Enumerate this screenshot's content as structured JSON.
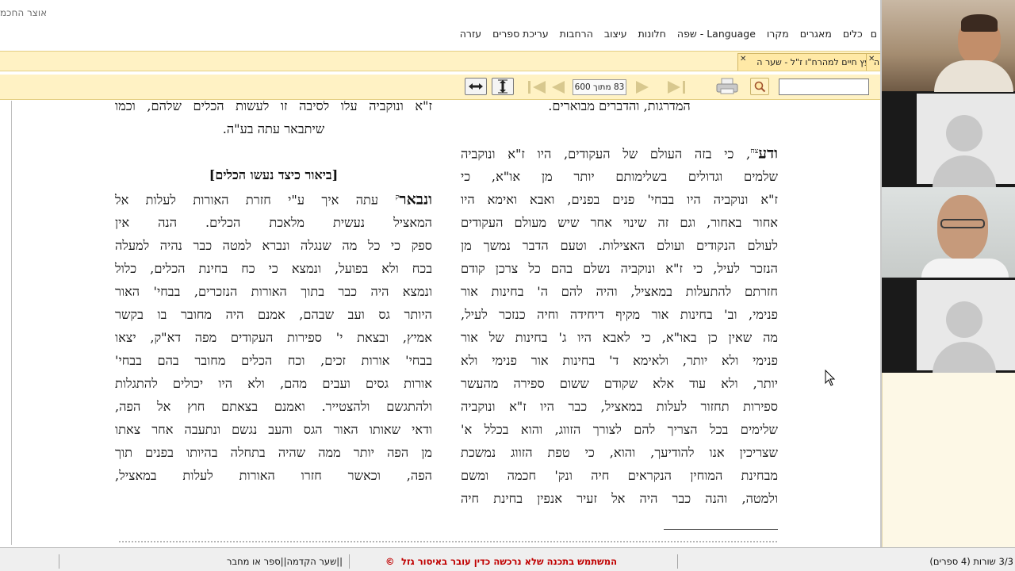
{
  "window": {
    "title": "אוצר החכמ"
  },
  "menu": [
    "כלים",
    "מאגרים",
    "מקרו",
    "Language - שפה",
    "חלונות",
    "עיצוב",
    "הרחבות",
    "עריכת ספרים",
    "עזרה"
  ],
  "menu_cut_left": "ם",
  "tabs": [
    {
      "label": "עץ חיים למהרח\"ו ז\"ל - שער ה"
    },
    {
      "label": "ה"
    }
  ],
  "toolbar": {
    "page_indicator": "83 מתוך 600",
    "search_value": ""
  },
  "document": {
    "right_column": [
      {
        "text": "המדרגות, והדברים מבוארים.",
        "style": "center"
      },
      {
        "text": "",
        "style": "blank"
      },
      {
        "lead": "ודע",
        "sup": "צח",
        "text": ", כי בזה העולם של העקודים, היו ז\"א ונוקביה",
        "style": "lead"
      },
      {
        "text": "שלמים וגדולים בשלימותם יותר מן או\"א, כי",
        "style": "normal"
      },
      {
        "text": "ז\"א ונוקביה היו בבחי' פנים בפנים, ואבא ואימא היו",
        "style": "normal"
      },
      {
        "text": "אחור באחור, וגם זה שינוי אחר שיש מעולם העקודים",
        "style": "normal"
      },
      {
        "text": "לעולם הנקודים ועולם האצילות. וטעם הדבר נמשך מן",
        "style": "normal"
      },
      {
        "text": "הנזכר לעיל, כי ז\"א ונוקביה נשלם בהם כל צרכן קודם",
        "style": "normal"
      },
      {
        "text": "חזרתם להתעלות במאציל, והיה להם ה' בחינות אור",
        "style": "normal"
      },
      {
        "text": "פנימי, וב' בחינות אור מקיף דיחידה וחיה כנזכר לעיל,",
        "style": "normal"
      },
      {
        "text": "מה שאין כן באו\"א, כי לאבא היו ג' בחינות של אור",
        "style": "normal"
      },
      {
        "text": "פנימי ולא יותר, ולאימא ד' בחינות אור פנימי ולא",
        "style": "normal"
      },
      {
        "text": "יותר, ולא עוד אלא שקודם ששום ספירה מהעשר",
        "style": "normal"
      },
      {
        "text": "ספירות תחזור לעלות במאציל, כבר היו ז\"א ונוקביה",
        "style": "normal"
      },
      {
        "text": "שלימים בכל הצריך להם לצורך הזווג, והוא בכלל א'",
        "style": "normal"
      },
      {
        "text": "שצריכין אנו להודיעך, והוא, כי טפת הזווג נמשכת",
        "style": "normal"
      },
      {
        "text": "מבחינת המוחין הנקראים חיה ונק' חכמה ומשם",
        "style": "normal"
      },
      {
        "text": "ולמטה, והנה כבר היה אל זעיר אנפין בחינת חיה",
        "style": "normal"
      }
    ],
    "left_column": [
      {
        "text": "ז\"א ונוקביה עלו לסיבה זו לעשות הכלים שלהם, וכמו",
        "style": "normal"
      },
      {
        "text": "שיתבאר עתה בע\"ה.",
        "style": "center"
      },
      {
        "text": "",
        "style": "blank"
      },
      {
        "text": "[ביאור כיצד נעשו הכלים]",
        "style": "heading"
      },
      {
        "lead": "ונבאר",
        "sup": "ק",
        "text": " עתה איך ע\"י חזרת האורות לעלות אל",
        "style": "lead"
      },
      {
        "text": "המאציל נעשית מלאכת הכלים. הנה אין",
        "style": "normal"
      },
      {
        "text": "ספק כי כל מה שנגלה ונברא למטה כבר נהיה למעלה",
        "style": "normal"
      },
      {
        "text": "בכח ולא בפועל, ונמצא כי כח בחינת הכלים, כלול",
        "style": "normal"
      },
      {
        "text": "ונמצא היה כבר בתוך האורות הנזכרים, בבחי' האור",
        "style": "normal"
      },
      {
        "text": "היותר גס ועב שבהם, אמנם היה מחובר בו בקשר",
        "style": "normal"
      },
      {
        "text": "אמיץ, ובצאת י' ספירות העקודים מפה דא\"ק, יצאו",
        "style": "normal"
      },
      {
        "text": "בבחי' אורות זכים, וכח הכלים מחובר בהם בבחי'",
        "style": "normal"
      },
      {
        "text": "אורות גסים ועבים מהם, ולא היו יכולים להתגלות",
        "style": "normal"
      },
      {
        "text": "ולהתגשם ולהצטייר. ואמנם בצאתם חוץ אל הפה,",
        "style": "normal"
      },
      {
        "text": "ודאי שאותו האור הגס והעב נגשם ונתעבה אחר צאתו",
        "style": "normal"
      },
      {
        "text": "מן הפה יותר ממה שהיה בתחלה בהיותו בפנים תוך",
        "style": "normal"
      },
      {
        "text": "הפה, וכאשר חזרו האורות לעלות במאציל,",
        "style": "normal"
      }
    ]
  },
  "status": {
    "lines": "3/3 שורות (4 ספרים)",
    "warning": "המשתמש בתכנה שלא נרכשה כדין עובר באיסור גזל",
    "copyright": "©",
    "location": "||שער הקדמה||ספר או מחבר"
  },
  "colors": {
    "accent_bar": "#fff2c4",
    "warning_text": "#c00000"
  }
}
